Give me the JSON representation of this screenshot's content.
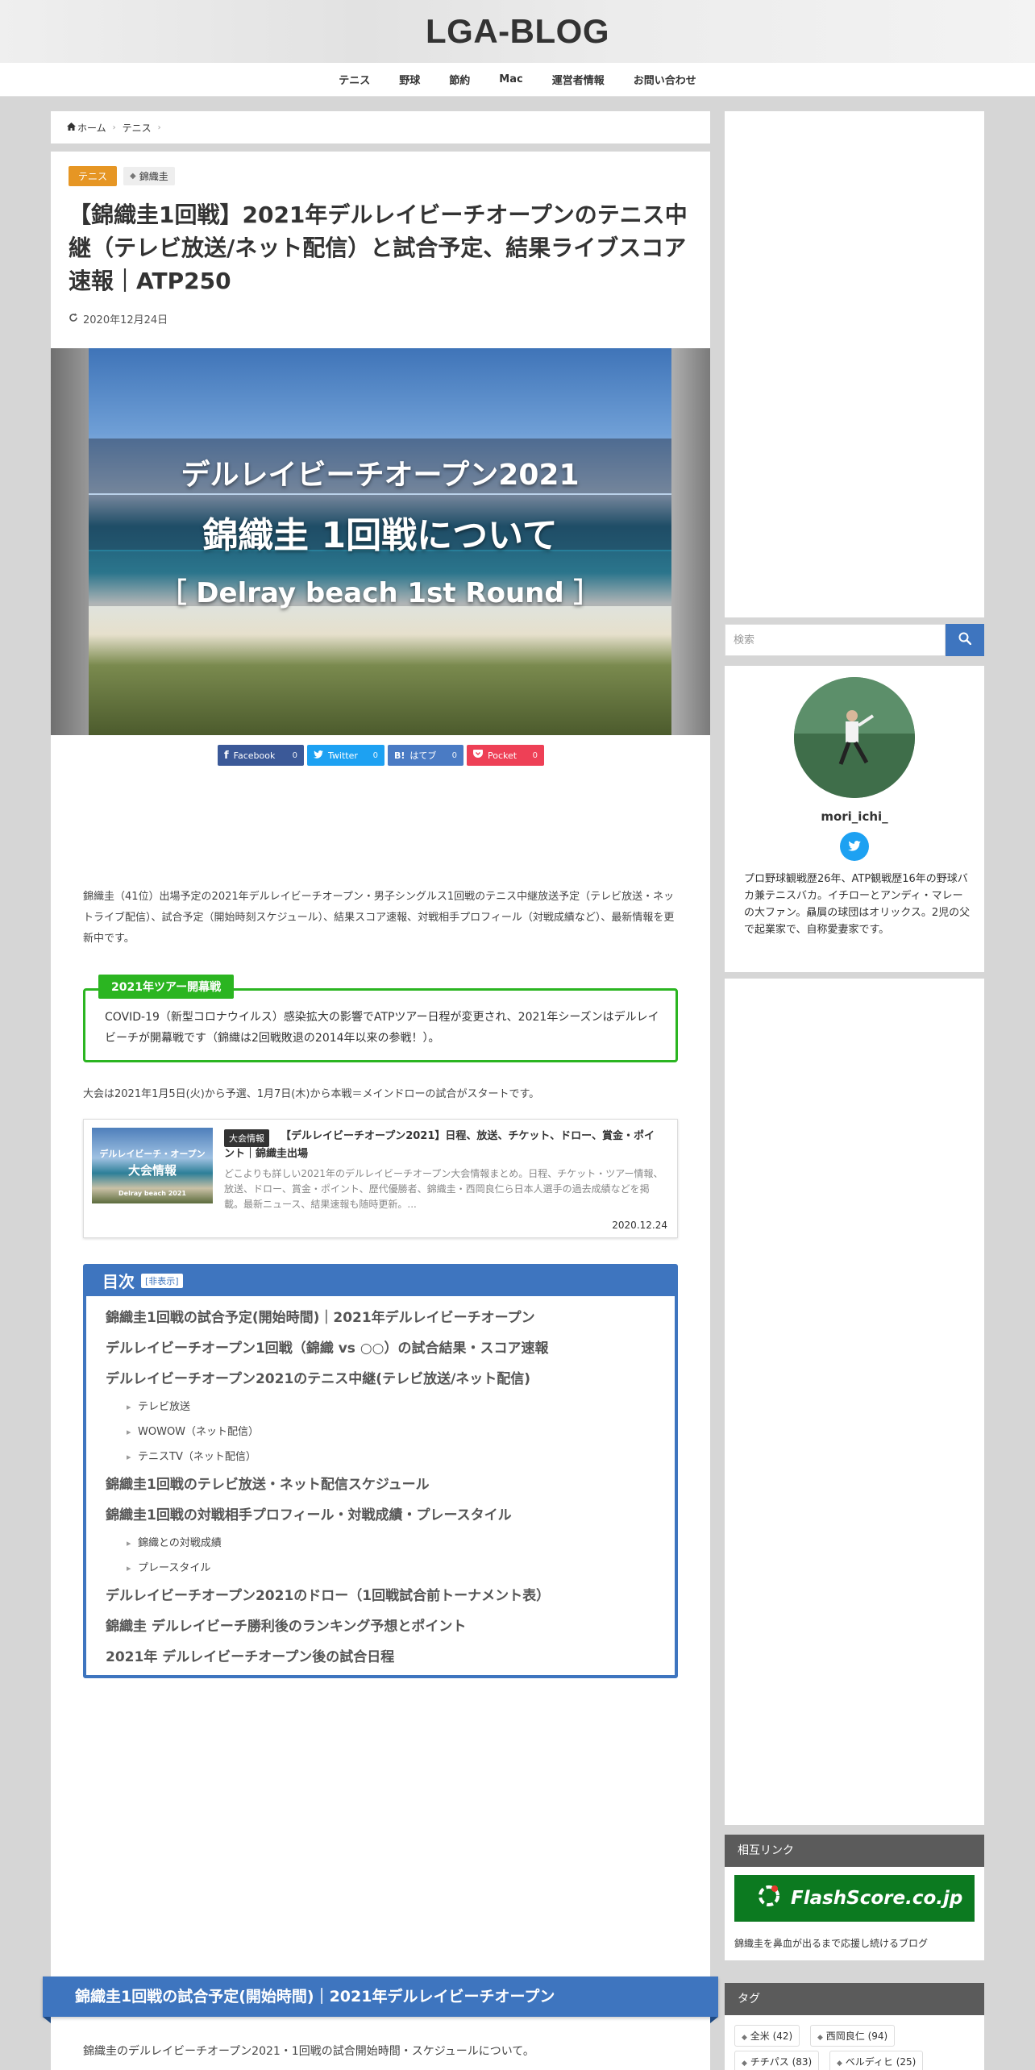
{
  "site": {
    "title": "LGA-BLOG"
  },
  "nav": {
    "items": [
      "テニス",
      "野球",
      "節約",
      "Mac",
      "運営者情報",
      "お問い合わせ"
    ]
  },
  "breadcrumb": {
    "home": "ホーム",
    "category": "テニス"
  },
  "article": {
    "category": "テニス",
    "tag": "錦織圭",
    "title": "【錦織圭1回戦】2021年デルレイビーチオープンのテニス中継（テレビ放送/ネット配信）と試合予定、結果ライブスコア速報｜ATP250",
    "date": "2020年12月24日",
    "hero": {
      "line1": "デルレイビーチオープン2021",
      "line2": "錦織圭 1回戦について",
      "line3": "［ Delray beach 1st Round ］"
    },
    "share": {
      "facebook": {
        "label": "Facebook",
        "count": "0"
      },
      "twitter": {
        "label": "Twitter",
        "count": "0"
      },
      "hatebu": {
        "label": "はてブ",
        "count": "0"
      },
      "pocket": {
        "label": "Pocket",
        "count": "0"
      }
    },
    "intro": "錦織圭（41位）出場予定の2021年デルレイビーチオープン・男子シングルス1回戦のテニス中継放送予定（テレビ放送・ネットライブ配信）、試合予定（開始時刻スケジュール）、結果スコア速報、対戦相手プロフィール（対戦成績など）、最新情報を更新中です。",
    "note": {
      "label": "2021年ツアー開幕戦",
      "text": "COVID-19（新型コロナウイルス）感染拡大の影響でATPツアー日程が変更され、2021年シーズンはデルレイビーチが開幕戦です（錦織は2回戦敗退の2014年以来の参戦！）。"
    },
    "schedule_line": "大会は2021年1月5日(火)から予選、1月7日(木)から本戦＝メインドローの試合がスタートです。",
    "card": {
      "thumb_line1": "デルレイビーチ・オープン",
      "thumb_line2": "大会情報",
      "thumb_line3": "Delray beach 2021",
      "category": "大会情報",
      "title": "【デルレイビーチオープン2021】日程、放送、チケット、ドロー、賞金・ポイント｜錦織圭出場",
      "desc": "どこよりも詳しい2021年のデルレイビーチオープン大会情報まとめ。日程、チケット・ツアー情報、放送、ドロー、賞金・ポイント、歴代優勝者、錦織圭・西岡良仁ら日本人選手の過去成績などを掲載。最新ニュース、結果速報も随時更新。...",
      "date": "2020.12.24"
    },
    "toc": {
      "title": "目次",
      "toggle": "[非表示]",
      "items": [
        {
          "level": 2,
          "text": "錦織圭1回戦の試合予定(開始時間)｜2021年デルレイビーチオープン"
        },
        {
          "level": 2,
          "text": "デルレイビーチオープン1回戦（錦織 vs ○○）の試合結果・スコア速報"
        },
        {
          "level": 2,
          "text": "デルレイビーチオープン2021のテニス中継(テレビ放送/ネット配信)"
        },
        {
          "level": 3,
          "text": "テレビ放送"
        },
        {
          "level": 3,
          "text": "WOWOW（ネット配信）"
        },
        {
          "level": 3,
          "text": "テニスTV（ネット配信）"
        },
        {
          "level": 2,
          "text": "錦織圭1回戦のテレビ放送・ネット配信スケジュール"
        },
        {
          "level": 2,
          "text": "錦織圭1回戦の対戦相手プロフィール・対戦成績・プレースタイル"
        },
        {
          "level": 3,
          "text": "錦織との対戦成績"
        },
        {
          "level": 3,
          "text": "プレースタイル"
        },
        {
          "level": 2,
          "text": "デルレイビーチオープン2021のドロー（1回戦試合前トーナメント表）"
        },
        {
          "level": 2,
          "text": "錦織圭 デルレイビーチ勝利後のランキング予想とポイント"
        },
        {
          "level": 2,
          "text": "2021年 デルレイビーチオープン後の試合日程"
        }
      ]
    },
    "h2": "錦織圭1回戦の試合予定(開始時間)｜2021年デルレイビーチオープン",
    "h2_sub": "錦織圭のデルレイビーチオープン2021・1回戦の試合開始時間・スケジュールについて。"
  },
  "sidebar": {
    "search_placeholder": "検索",
    "profile": {
      "name": "mori_ichi_",
      "desc": "プロ野球観戦歴26年、ATP観戦歴16年の野球バカ兼テニスバカ。イチローとアンディ・マレーの大ファン。贔屓の球団はオリックス。2児の父で起業家で、自称愛妻家です。"
    },
    "links": {
      "heading": "相互リンク",
      "banner": "FlashScore.co.jp",
      "caption": "錦織圭を鼻血が出るまで応援し続けるブログ"
    },
    "tags": {
      "heading": "タグ",
      "items": [
        "全米 (42)",
        "西岡良仁 (94)",
        "チチパス (83)",
        "ベルディヒ (25)"
      ]
    }
  },
  "colors": {
    "accent": "#3e75bf",
    "category": "#e69624",
    "note_green": "#2bb521",
    "facebook": "#3b5998",
    "twitter": "#1da1f2",
    "hatebu": "#4a7bc4",
    "pocket": "#ee4056",
    "flashscore": "#0c7a20"
  }
}
